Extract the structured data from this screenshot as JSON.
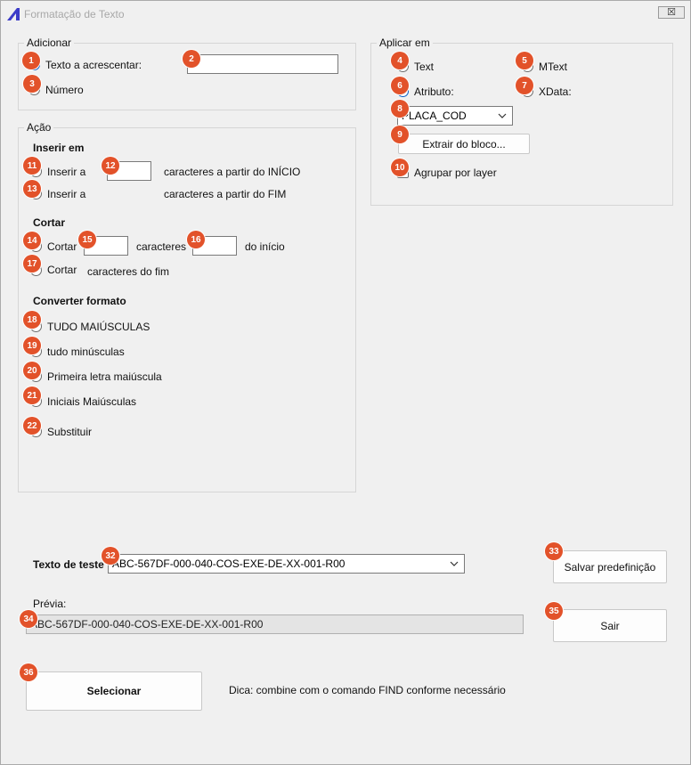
{
  "window": {
    "title": "Formatação de Texto",
    "close_glyph": "☒"
  },
  "adicionar": {
    "title": "Adicionar",
    "texto_label": "Texto a acrescentar:",
    "texto_value": "",
    "numero_label": "Número"
  },
  "aplicar": {
    "title": "Aplicar em",
    "text_label": "Text",
    "mtext_label": "MText",
    "atributo_label": "Atributo:",
    "xdata_label": "XData:",
    "atributo_value": "PLACA_COD",
    "extrair_label": "Extrair do bloco...",
    "agrupar_label": "Agrupar por layer"
  },
  "acao": {
    "title": "Ação",
    "inserir_heading": "Inserir em",
    "inserir_a_label": "Inserir a",
    "inicio_suffix": "caracteres a partir do INÍCIO",
    "fim_suffix": "caracteres a partir do FIM",
    "cortar_heading": "Cortar",
    "cortar_label": "Cortar",
    "caracteres_label": "caracteres",
    "do_inicio_label": "do início",
    "caracteres_fim_label": "caracteres do fim",
    "converter_heading": "Converter formato",
    "upper_label": "TUDO MAIÚSCULAS",
    "lower_label": "tudo minúsculas",
    "sentence_label": "Primeira letra maiúscula",
    "title_label": "Iniciais Maiúsculas",
    "substituir_label": "Substituir"
  },
  "bottom": {
    "texto_teste_label": "Texto de teste",
    "texto_teste_value": "ABC-567DF-000-040-COS-EXE-DE-XX-001-R00",
    "previa_label": "Prévia:",
    "previa_value": "ABC-567DF-000-040-COS-EXE-DE-XX-001-R00",
    "salvar_label": "Salvar predefinição",
    "sair_label": "Sair",
    "selecionar_label": "Selecionar",
    "dica": "Dica: combine com o comando FIND conforme necessário"
  },
  "badges": [
    "1",
    "2",
    "3",
    "4",
    "5",
    "6",
    "7",
    "8",
    "9",
    "10",
    "11",
    "12",
    "13",
    "14",
    "15",
    "16",
    "17",
    "18",
    "19",
    "20",
    "21",
    "22",
    "32",
    "33",
    "34",
    "35",
    "36"
  ],
  "colors": {
    "badge": "#e2522a",
    "radio_selected": "#0a5fc6",
    "app_icon": "#3c3cc8"
  }
}
